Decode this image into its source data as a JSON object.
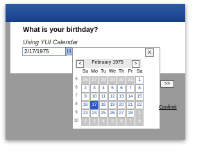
{
  "form": {
    "question": "What is your birthday?",
    "subtitle": "Using YUI Calendar",
    "date_value": "2/17/1975",
    "next_label": ">>",
    "confirm_label": "Confimit"
  },
  "calendar": {
    "close_label": "x",
    "prev_label": "<",
    "next_label": ">",
    "month_title": "February 1975",
    "weekdays": [
      "Su",
      "Mo",
      "Tu",
      "We",
      "Th",
      "Fr",
      "Sa"
    ],
    "weeks": [
      {
        "num": "5",
        "days": [
          {
            "d": "26",
            "s": "out"
          },
          {
            "d": "27",
            "s": "out"
          },
          {
            "d": "28",
            "s": "out"
          },
          {
            "d": "29",
            "s": "out"
          },
          {
            "d": "30",
            "s": "out"
          },
          {
            "d": "31",
            "s": "out"
          },
          {
            "d": "1",
            "s": "cur"
          }
        ]
      },
      {
        "num": "6",
        "days": [
          {
            "d": "2",
            "s": "cur"
          },
          {
            "d": "3",
            "s": "cur"
          },
          {
            "d": "4",
            "s": "cur"
          },
          {
            "d": "5",
            "s": "cur"
          },
          {
            "d": "6",
            "s": "cur"
          },
          {
            "d": "7",
            "s": "cur"
          },
          {
            "d": "8",
            "s": "cur"
          }
        ]
      },
      {
        "num": "7",
        "days": [
          {
            "d": "9",
            "s": "cur"
          },
          {
            "d": "10",
            "s": "cur"
          },
          {
            "d": "11",
            "s": "cur"
          },
          {
            "d": "12",
            "s": "cur"
          },
          {
            "d": "13",
            "s": "cur"
          },
          {
            "d": "14",
            "s": "cur"
          },
          {
            "d": "15",
            "s": "cur"
          }
        ]
      },
      {
        "num": "8",
        "days": [
          {
            "d": "16",
            "s": "cur"
          },
          {
            "d": "17",
            "s": "sel"
          },
          {
            "d": "18",
            "s": "cur"
          },
          {
            "d": "19",
            "s": "cur"
          },
          {
            "d": "20",
            "s": "cur"
          },
          {
            "d": "21",
            "s": "cur"
          },
          {
            "d": "22",
            "s": "cur"
          }
        ]
      },
      {
        "num": "9",
        "days": [
          {
            "d": "23",
            "s": "cur"
          },
          {
            "d": "24",
            "s": "cur"
          },
          {
            "d": "25",
            "s": "cur"
          },
          {
            "d": "26",
            "s": "cur"
          },
          {
            "d": "27",
            "s": "cur"
          },
          {
            "d": "28",
            "s": "cur"
          },
          {
            "d": "1",
            "s": "out"
          }
        ]
      },
      {
        "num": "10",
        "days": [
          {
            "d": "2",
            "s": "out"
          },
          {
            "d": "3",
            "s": "out"
          },
          {
            "d": "4",
            "s": "out"
          },
          {
            "d": "5",
            "s": "out"
          },
          {
            "d": "6",
            "s": "out"
          },
          {
            "d": "7",
            "s": "out"
          },
          {
            "d": "8",
            "s": "out"
          }
        ]
      }
    ]
  },
  "colors": {
    "header_blue": "#1f4a96",
    "selected_day": "#2a57c7",
    "current_day_text": "#2a4fa2"
  }
}
